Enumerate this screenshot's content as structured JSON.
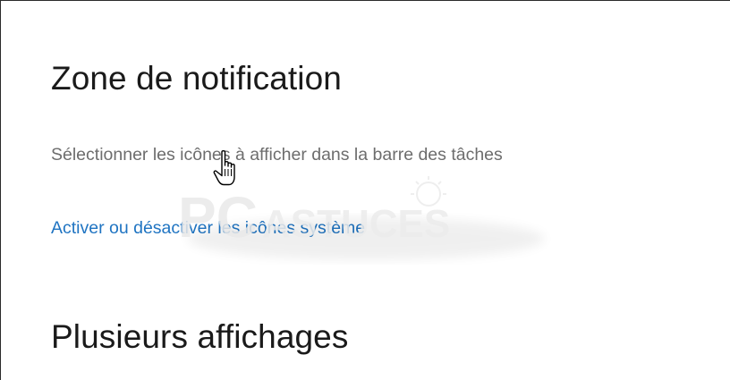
{
  "sections": {
    "notification_area": {
      "title": "Zone de notification",
      "select_icons_text": "Sélectionner les icônes à afficher dans la barre des tâches",
      "system_icons_link": "Activer ou désactiver les icônes système"
    },
    "multiple_displays": {
      "title": "Plusieurs affichages"
    }
  },
  "watermark": {
    "text": "PCASTUCES"
  },
  "colors": {
    "link": "#1f74c2",
    "secondary_text": "#6d6d6d",
    "heading": "#1a1a1a"
  },
  "icons": {
    "cursor": "hand-pointer-icon"
  }
}
